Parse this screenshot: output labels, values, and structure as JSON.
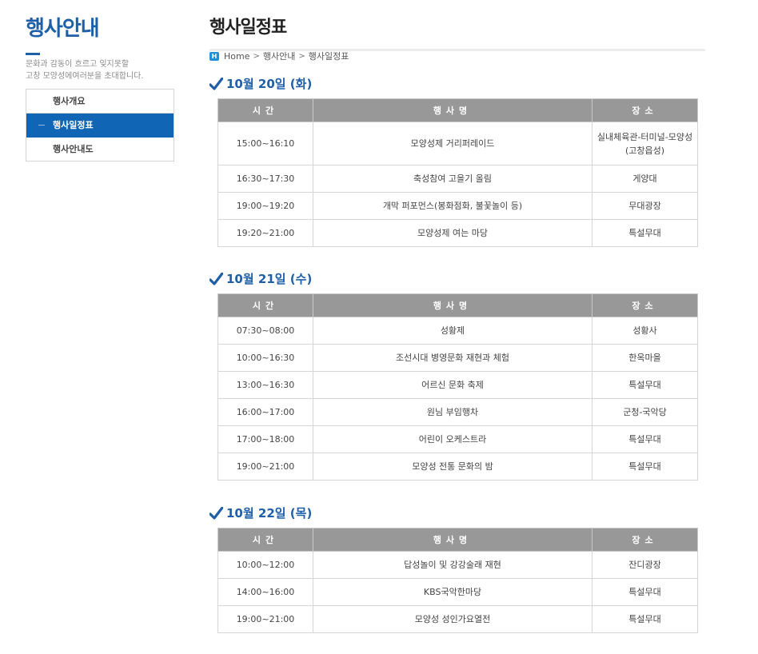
{
  "sidebar": {
    "title": "행사안내",
    "desc": "문화과 감동이 흐르고 잊지못할\n고창 모양성에여러분을 초대합니다.",
    "items": [
      {
        "label": "행사개요",
        "active": false
      },
      {
        "label": "행사일정표",
        "active": true
      },
      {
        "label": "행사안내도",
        "active": false
      }
    ]
  },
  "main": {
    "title": "행사일정표",
    "breadcrumb": {
      "home_icon": "H",
      "home": "Home",
      "sep1": ">",
      "level1": "행사안내",
      "sep2": ">",
      "level2": "행사일정표"
    },
    "table_headers": {
      "time": "시간",
      "name": "행사명",
      "place": "장소"
    },
    "days": [
      {
        "heading": "10월 20일 (화)",
        "rows": [
          {
            "time": "15:00~16:10",
            "name": "모양성제 거리퍼레이드",
            "place": "실내체육관-터미널-모양성(고창읍성)"
          },
          {
            "time": "16:30~17:30",
            "name": "축성참여 고을기 올림",
            "place": "게양대"
          },
          {
            "time": "19:00~19:20",
            "name": "개막 퍼포먼스(봉화점화, 불꽃놀이 등)",
            "place": "무대광장"
          },
          {
            "time": "19:20~21:00",
            "name": "모양성제 여는 마당",
            "place": "특설무대"
          }
        ]
      },
      {
        "heading": "10월 21일 (수)",
        "rows": [
          {
            "time": "07:30~08:00",
            "name": "성황제",
            "place": "성황사"
          },
          {
            "time": "10:00~16:30",
            "name": "조선시대 병영문화 재현과 체험",
            "place": "한옥마을"
          },
          {
            "time": "13:00~16:30",
            "name": "어르신 문화 축제",
            "place": "특설무대"
          },
          {
            "time": "16:00~17:00",
            "name": "원님 부임행차",
            "place": "군청-국악당"
          },
          {
            "time": "17:00~18:00",
            "name": "어린이 오케스트라",
            "place": "특설무대"
          },
          {
            "time": "19:00~21:00",
            "name": "모양성 전통 문화의 밤",
            "place": "특설무대"
          }
        ]
      },
      {
        "heading": "10월 22일 (목)",
        "rows": [
          {
            "time": "10:00~12:00",
            "name": "답성놀이 및 강강술래 재현",
            "place": "잔디광장"
          },
          {
            "time": "14:00~16:00",
            "name": "KBS국악한마당",
            "place": "특설무대"
          },
          {
            "time": "19:00~21:00",
            "name": "모양성 성인가요열전",
            "place": "특설무대"
          }
        ]
      }
    ]
  },
  "icons": {
    "check": "check-icon",
    "home": "home-icon"
  },
  "colors": {
    "brand": "#1f5fa8",
    "active_menu": "#1066b4",
    "table_header": "#989898"
  }
}
